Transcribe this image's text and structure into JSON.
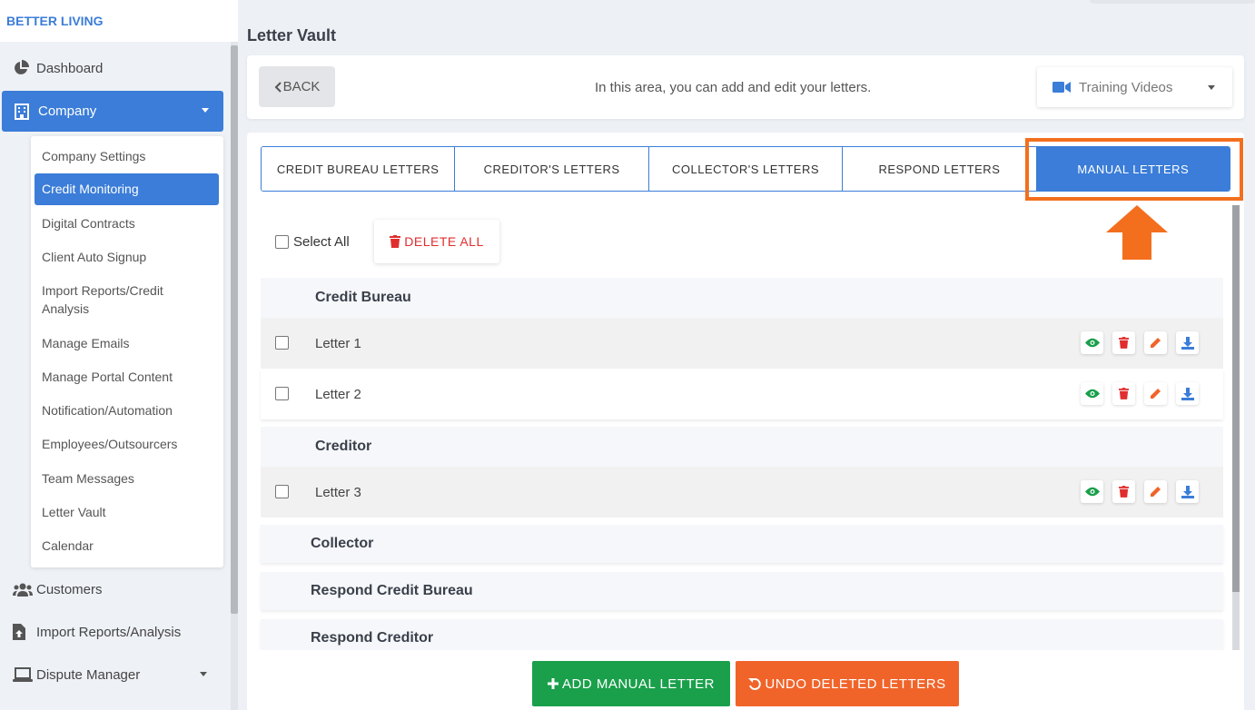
{
  "brand": "BETTER LIVING",
  "sidebar": {
    "items": [
      {
        "label": "Dashboard",
        "icon": "pie-chart-icon"
      },
      {
        "label": "Company",
        "icon": "building-icon"
      },
      {
        "label": "Customers",
        "icon": "users-icon"
      },
      {
        "label": "Import Reports/Analysis",
        "icon": "file-upload-icon"
      },
      {
        "label": "Dispute Manager",
        "icon": "laptop-icon"
      }
    ],
    "submenu": [
      "Company Settings",
      "Credit Monitoring",
      "Digital Contracts",
      "Client Auto Signup",
      "Import Reports/Credit Analysis",
      "Manage Emails",
      "Manage Portal Content",
      "Notification/Automation",
      "Employees/Outsourcers",
      "Team Messages",
      "Letter Vault",
      "Calendar"
    ],
    "active_submenu": "Credit Monitoring"
  },
  "header": {
    "title": "Letter Vault",
    "back_label": "BACK",
    "intro": "In this area, you can add and edit your letters.",
    "training_label": "Training Videos"
  },
  "tabs": [
    "CREDIT BUREAU LETTERS",
    "CREDITOR'S LETTERS",
    "COLLECTOR'S LETTERS",
    "RESPOND LETTERS",
    "MANUAL LETTERS"
  ],
  "active_tab": "MANUAL LETTERS",
  "toolbar": {
    "select_all": "Select All",
    "delete_all": "DELETE ALL"
  },
  "groups": {
    "credit_bureau": {
      "title": "Credit Bureau",
      "letters": [
        "Letter 1",
        "Letter 2"
      ]
    },
    "creditor": {
      "title": "Creditor",
      "letters": [
        "Letter 3"
      ]
    },
    "collector": {
      "title": "Collector"
    },
    "respond_credit_bureau": {
      "title": "Respond Credit Bureau"
    },
    "respond_creditor": {
      "title": "Respond Creditor"
    }
  },
  "footer": {
    "add_label": "ADD MANUAL LETTER",
    "undo_label": "UNDO DELETED LETTERS"
  },
  "colors": {
    "primary": "#3b7dd8",
    "highlight": "#f36f1d",
    "add": "#1a9f4b",
    "undo": "#f0642a",
    "delete": "#e02e2e",
    "view": "#1a9f4b",
    "edit": "#f0642a",
    "download": "#3b7dd8"
  }
}
